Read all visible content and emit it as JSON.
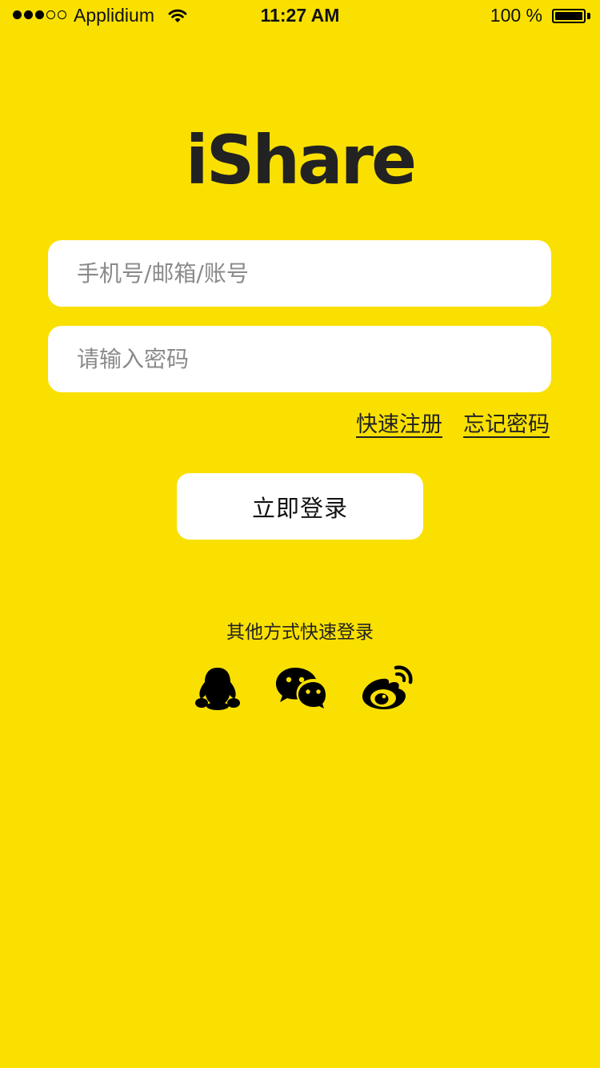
{
  "status_bar": {
    "carrier": "Applidium",
    "time": "11:27 AM",
    "battery_percent": "100 %",
    "signal_bars_filled": 3,
    "signal_bars_total": 5,
    "battery_level": 1.0
  },
  "logo": {
    "text": "iShare"
  },
  "login_form": {
    "account_placeholder": "手机号/邮箱/账号",
    "password_placeholder": "请输入密码",
    "register_link": "快速注册",
    "forgot_password_link": "忘记密码",
    "login_button": "立即登录"
  },
  "social_login": {
    "title": "其他方式快速登录",
    "providers": [
      {
        "icon": "qq-icon"
      },
      {
        "icon": "wechat-icon"
      },
      {
        "icon": "weibo-icon"
      }
    ]
  },
  "colors": {
    "background": "#F9E000",
    "card": "#FFFFFF",
    "text": "#222222"
  }
}
